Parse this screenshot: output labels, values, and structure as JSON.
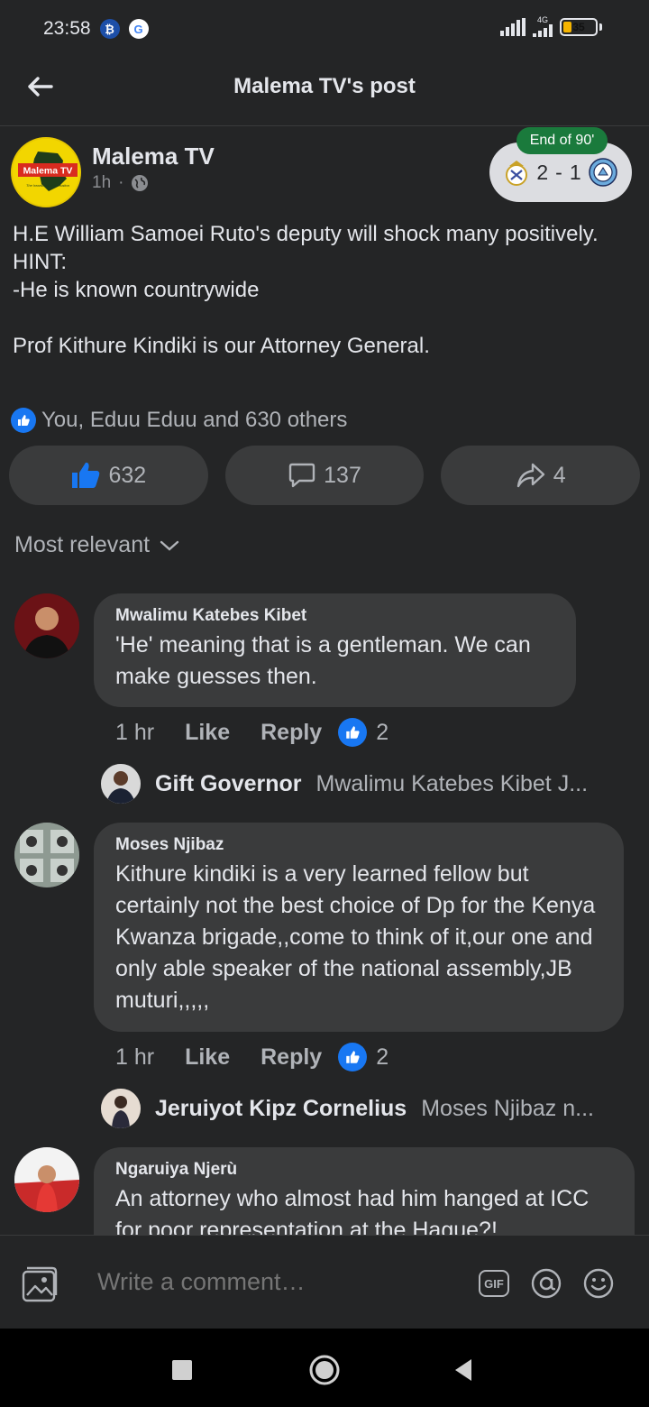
{
  "status_bar": {
    "time": "23:58",
    "network_label": "4G",
    "battery_level": "35",
    "battery_fraction": 0.35
  },
  "header": {
    "title": "Malema TV's post"
  },
  "post": {
    "page_name": "Malema TV",
    "time": "1h",
    "separator": "·",
    "avatar_logo_text": "Malema TV",
    "avatar_tagline": "The heartbeat of the nation",
    "body_lines": [
      "H.E William Samoei Ruto's deputy will shock many positively.",
      "HINT:",
      "-He is known countrywide",
      "",
      "Prof Kithure Kindiki is our Attorney General."
    ],
    "reaction_summary": "You, Eduu Eduu and 630 others",
    "like_count": "632",
    "comment_count": "137",
    "share_count": "4"
  },
  "score_widget": {
    "status": "End of 90'",
    "home_score": "2",
    "separator": "-",
    "away_score": "1"
  },
  "comments_sort": {
    "label": "Most relevant"
  },
  "comments": [
    {
      "author": "Mwalimu Katebes Kibet",
      "text": "'He' meaning that is a gentleman. We can make guesses then.",
      "time": "1 hr",
      "like_label": "Like",
      "reply_label": "Reply",
      "reactions": "2",
      "reply_author": "Gift Governor",
      "reply_text": "Mwalimu Katebes Kibet J..."
    },
    {
      "author": "Moses Njibaz",
      "text": "Kithure kindiki is a very learned fellow but certainly not the best choice of Dp for the Kenya Kwanza brigade,,come to think of it,our one and only able speaker of the national assembly,JB muturi,,,,,",
      "time": "1 hr",
      "like_label": "Like",
      "reply_label": "Reply",
      "reactions": "2",
      "reply_author": "Jeruiyot Kipz Cornelius",
      "reply_text": "Moses Njibaz n..."
    },
    {
      "author": "Ngaruiya Njerù",
      "text": "An attorney who almost had him hanged at ICC for poor representation at the Hague?!"
    }
  ],
  "composer": {
    "placeholder": "Write a comment…",
    "gif_label": "GIF"
  },
  "colors": {
    "background": "#242526",
    "bubble": "#3a3b3c",
    "accent_blue": "#1877f2",
    "score_green": "#1a7a3c"
  }
}
